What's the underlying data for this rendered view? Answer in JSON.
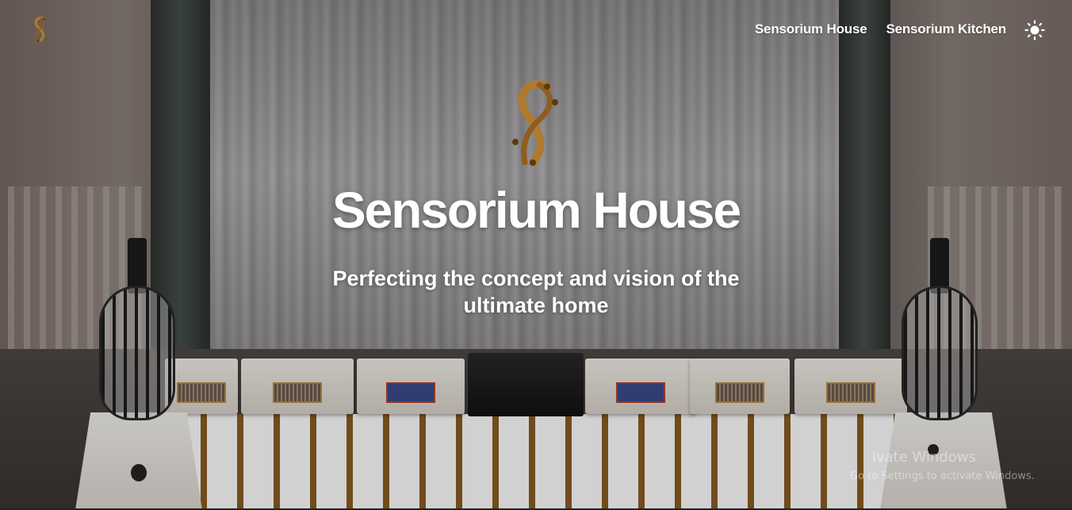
{
  "header": {
    "logo_icon": "sensorium-s-logo-icon",
    "nav": [
      {
        "label": "Sensorium House"
      },
      {
        "label": "Sensorium Kitchen"
      }
    ],
    "theme_toggle_icon": "sun-icon"
  },
  "hero": {
    "logo_icon": "sensorium-s-logo-icon",
    "title": "Sensorium House",
    "subtitle": "Perfecting the concept and vision of the ultimate home",
    "background_image": "audio-room-photo"
  },
  "watermark": {
    "line1": "ivate Windows",
    "line2": "Go to Settings to activate Windows."
  },
  "colors": {
    "logo_gold": "#b07a2e",
    "text": "#ffffff"
  }
}
